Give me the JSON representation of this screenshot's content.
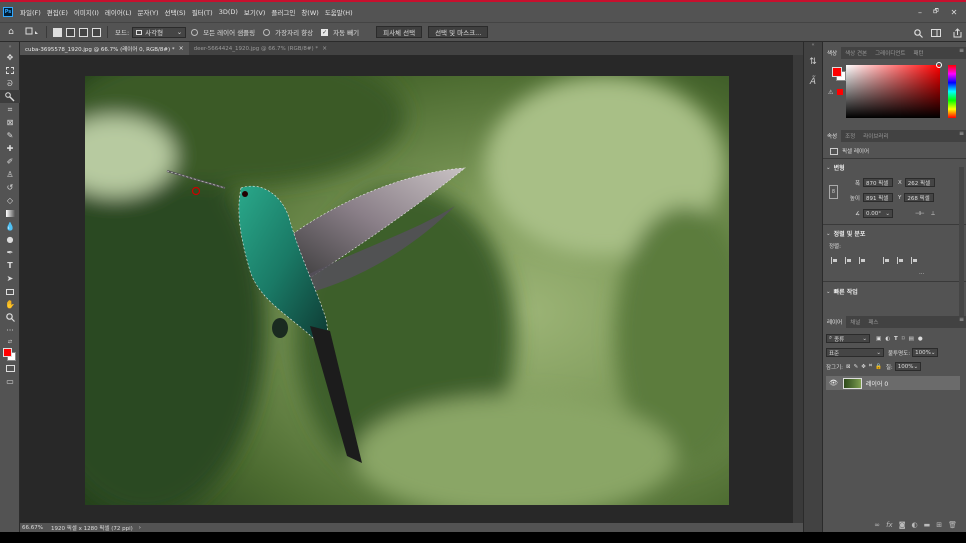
{
  "menubar": {
    "logo": "Ps",
    "items": [
      "파일(F)",
      "편집(E)",
      "이미지(I)",
      "레이어(L)",
      "문자(Y)",
      "선택(S)",
      "필터(T)",
      "3D(D)",
      "보기(V)",
      "플러그인",
      "창(W)",
      "도움말(H)"
    ],
    "window_controls": [
      "–",
      "🗗",
      "✕"
    ]
  },
  "options": {
    "mode_label": "모드:",
    "mode_value": "사각형",
    "sample_all_layers": "모든 레이어 샘플링",
    "enhance_edges": "가장자리 향상",
    "auto_enhance": "자동 빼기",
    "select_subject": "피사체 선택",
    "select_and_mask": "선택 및 마스크..."
  },
  "tabs": [
    {
      "label": "cuba-3695578_1920.jpg @ 66.7% (레이어 0, RGB/8#) *",
      "close": "×"
    },
    {
      "label": "deer-5664424_1920.jpg @ 66.7% (RGB/8#) *",
      "close": "×"
    }
  ],
  "status": {
    "zoom": "66.67%",
    "info": "1920 픽셀 x 1280 픽셀 (72 ppi)",
    "arrow": "›"
  },
  "color_panel": {
    "tabs": [
      "색상",
      "색상 견본",
      "그레이디언트",
      "패턴"
    ],
    "foreground": "#ff0000",
    "background": "#ffffff",
    "hue": "#ff0000"
  },
  "properties_panel": {
    "tabs": [
      "속성",
      "조정",
      "라이브러리"
    ],
    "type": "픽셀 레이어",
    "transform_title": "변형",
    "w_label": "폭",
    "w_value": "870 픽셀",
    "x_label": "X",
    "x_value": "262 픽셀",
    "h_label": "높이",
    "h_value": "891 픽셀",
    "y_label": "Y",
    "y_value": "268 픽셀",
    "angle_value": "0.00°",
    "align_title": "정렬 및 분포",
    "align_label": "정렬:",
    "more": "...",
    "quick_title": "빠른 작업"
  },
  "layers_panel": {
    "tabs": [
      "레이어",
      "채널",
      "패스"
    ],
    "filter_kind": "종류",
    "blend_mode": "표준",
    "opacity_label": "불투명도:",
    "opacity_value": "100%",
    "lock_label": "잠그기:",
    "fill_label": "칠:",
    "fill_value": "100%",
    "layers": [
      {
        "name": "레이어 0",
        "visible": true
      }
    ],
    "footer_icons": [
      "link-icon",
      "fx-icon",
      "mask-icon",
      "adjustment-icon",
      "folder-icon",
      "new-layer-icon",
      "trash-icon"
    ]
  },
  "tools": [
    "move",
    "marquee",
    "lasso",
    "quick-select",
    "crop",
    "frame",
    "eyedropper",
    "healing",
    "brush",
    "stamp",
    "history-brush",
    "eraser",
    "gradient",
    "blur",
    "dodge",
    "pen",
    "type",
    "path-select",
    "rectangle",
    "hand",
    "zoom",
    "more"
  ]
}
